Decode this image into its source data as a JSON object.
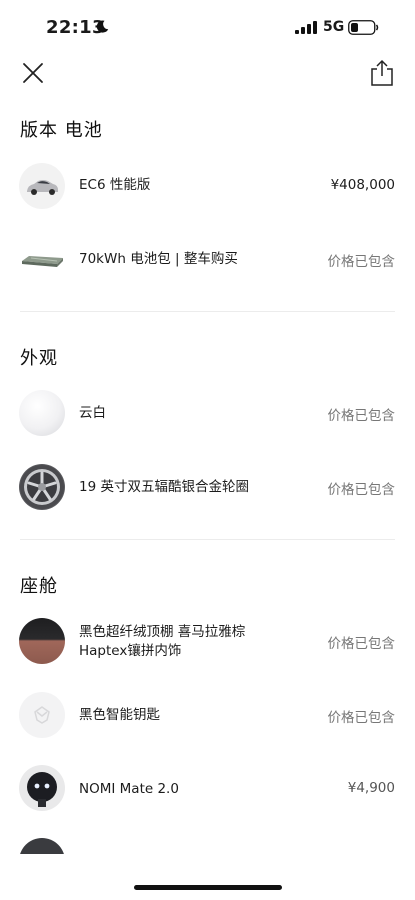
{
  "status_bar": {
    "time": "22:13",
    "network": "5G"
  },
  "sections": [
    {
      "title": "版本 电池",
      "items": [
        {
          "label": "EC6 性能版",
          "price": "¥408,000",
          "icon": "car-thumbnail"
        },
        {
          "label": "70kWh 电池包 | 整车购买",
          "price": "价格已包含",
          "icon": "battery-pack-thumbnail"
        }
      ]
    },
    {
      "title": "外观",
      "items": [
        {
          "label": "云白",
          "price": "价格已包含",
          "icon": "paint-swatch-white"
        },
        {
          "label": "19 英寸双五辐酷银合金轮圈",
          "price": "价格已包含",
          "icon": "wheel-thumbnail"
        }
      ]
    },
    {
      "title": "座舱",
      "items": [
        {
          "label_line1": "黑色超纤绒顶棚 喜马拉雅棕",
          "label_line2": "Haptex镶拼内饰",
          "price": "价格已包含",
          "icon": "interior-swatch"
        },
        {
          "label": "黑色智能钥匙",
          "price": "价格已包含",
          "icon": "smart-key-thumbnail"
        },
        {
          "label": "NOMI Mate 2.0",
          "price": "¥4,900",
          "icon": "nomi-thumbnail"
        }
      ]
    }
  ],
  "colors": {
    "price_included": "#777777",
    "divider": "#ececec",
    "interior_brown": "#a0675a"
  }
}
